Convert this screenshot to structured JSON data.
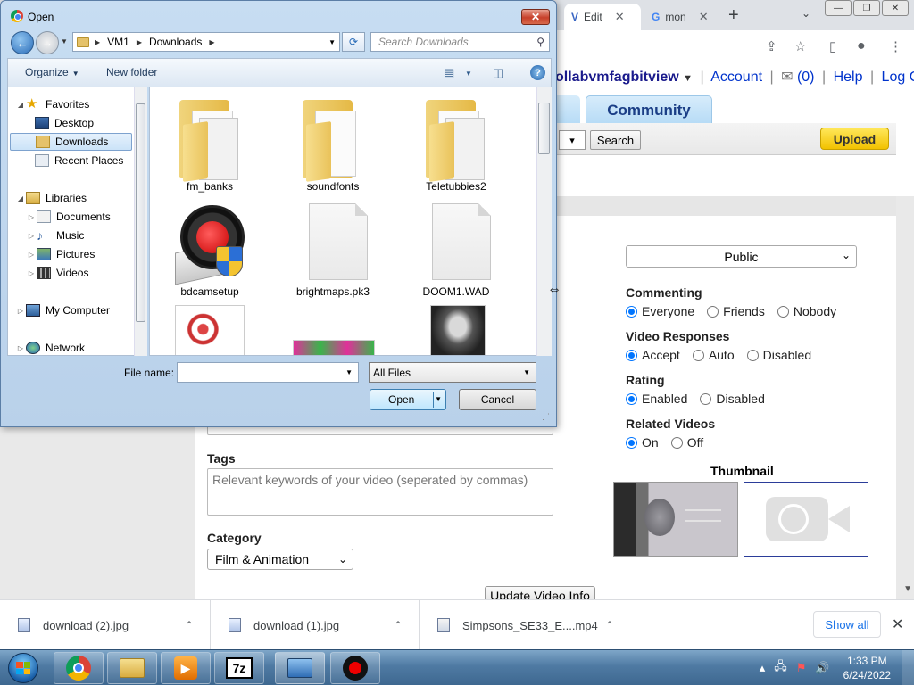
{
  "browser": {
    "tabs": [
      {
        "title": "Edit",
        "icon": "vidlii-icon"
      },
      {
        "title": "mon",
        "icon": "google-icon"
      }
    ],
    "window_controls": [
      "minimize",
      "maximize",
      "close"
    ]
  },
  "site": {
    "username": "ollabvmfagbitview",
    "user_links": [
      "Account",
      "(0)",
      "Help",
      "Log Out"
    ],
    "nav_tab": "Community",
    "search_button": "Search",
    "upload_button": "Upload",
    "privacy_value": "Public",
    "settings": [
      {
        "title": "Commenting",
        "options": [
          "Everyone",
          "Friends",
          "Nobody"
        ],
        "selected": 0
      },
      {
        "title": "Video Responses",
        "options": [
          "Accept",
          "Auto",
          "Disabled"
        ],
        "selected": 0
      },
      {
        "title": "Rating",
        "options": [
          "Enabled",
          "Disabled"
        ],
        "selected": 0
      },
      {
        "title": "Related Videos",
        "options": [
          "On",
          "Off"
        ],
        "selected": 0
      }
    ],
    "thumbnail_title": "Thumbnail",
    "tags_label": "Tags",
    "tags_placeholder": "Relevant keywords of your video (seperated by commas)",
    "category_label": "Category",
    "category_value": "Film & Animation",
    "update_button": "Update Video Info"
  },
  "downloads": {
    "items": [
      "download (2).jpg",
      "download (1).jpg",
      "Simpsons_SE33_E....mp4"
    ],
    "show_all": "Show all"
  },
  "taskbar": {
    "time": "1:33 PM",
    "date": "6/24/2022",
    "apps": [
      "chrome",
      "explorer",
      "media-player",
      "7zip",
      "control-panel",
      "bandicam"
    ]
  },
  "dialog": {
    "title": "Open",
    "breadcrumb": [
      "VM1",
      "Downloads"
    ],
    "search_placeholder": "Search Downloads",
    "organize": "Organize",
    "new_folder": "New folder",
    "nav": {
      "favorites": "Favorites",
      "desktop": "Desktop",
      "downloads": "Downloads",
      "recent": "Recent Places",
      "libraries": "Libraries",
      "documents": "Documents",
      "music": "Music",
      "pictures": "Pictures",
      "videos": "Videos",
      "computer": "My Computer",
      "network": "Network"
    },
    "files": [
      "fm_banks",
      "soundfonts",
      "Teletubbies2",
      "bdcamsetup",
      "brightmaps.pk3",
      "DOOM1.WAD"
    ],
    "file_name_label": "File name:",
    "filter_value": "All Files",
    "open_button": "Open",
    "cancel_button": "Cancel"
  }
}
